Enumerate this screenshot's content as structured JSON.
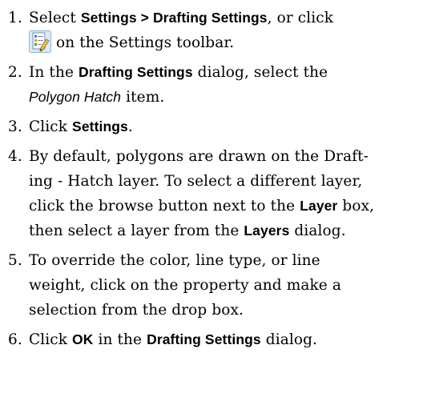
{
  "steps": [
    {
      "num": "1.",
      "t1": "Select ",
      "b1": "Settings > Drafting Settings",
      "t2": ", or click",
      "icon": "drafting-settings-icon",
      "t3": "on the Settings toolbar."
    },
    {
      "num": "2.",
      "t1": "In the ",
      "b1": "Drafting Settings",
      "t2": " dialog, select the",
      "i1": "Polygon Hatch",
      "t3": " item."
    },
    {
      "num": "3.",
      "t1": "Click ",
      "b1": "Settings",
      "t2": "."
    },
    {
      "num": "4.",
      "t1": "By default, polygons are drawn on the Draft-",
      "t2": "ing - Hatch layer. To select a different layer,",
      "t3": "click the browse button next to the ",
      "b1": "Layer",
      "t4": " box,",
      "t5": "then select a layer from the ",
      "b2": "Layers",
      "t6": " dialog."
    },
    {
      "num": "5.",
      "t1": "To override the color, line type, or line",
      "t2": "weight, click on the property and make a",
      "t3": "selection from the drop box."
    },
    {
      "num": "6.",
      "t1": "Click ",
      "b1": "OK",
      "t2": " in the ",
      "b2": "Drafting Settings",
      "t3": " dialog."
    }
  ]
}
